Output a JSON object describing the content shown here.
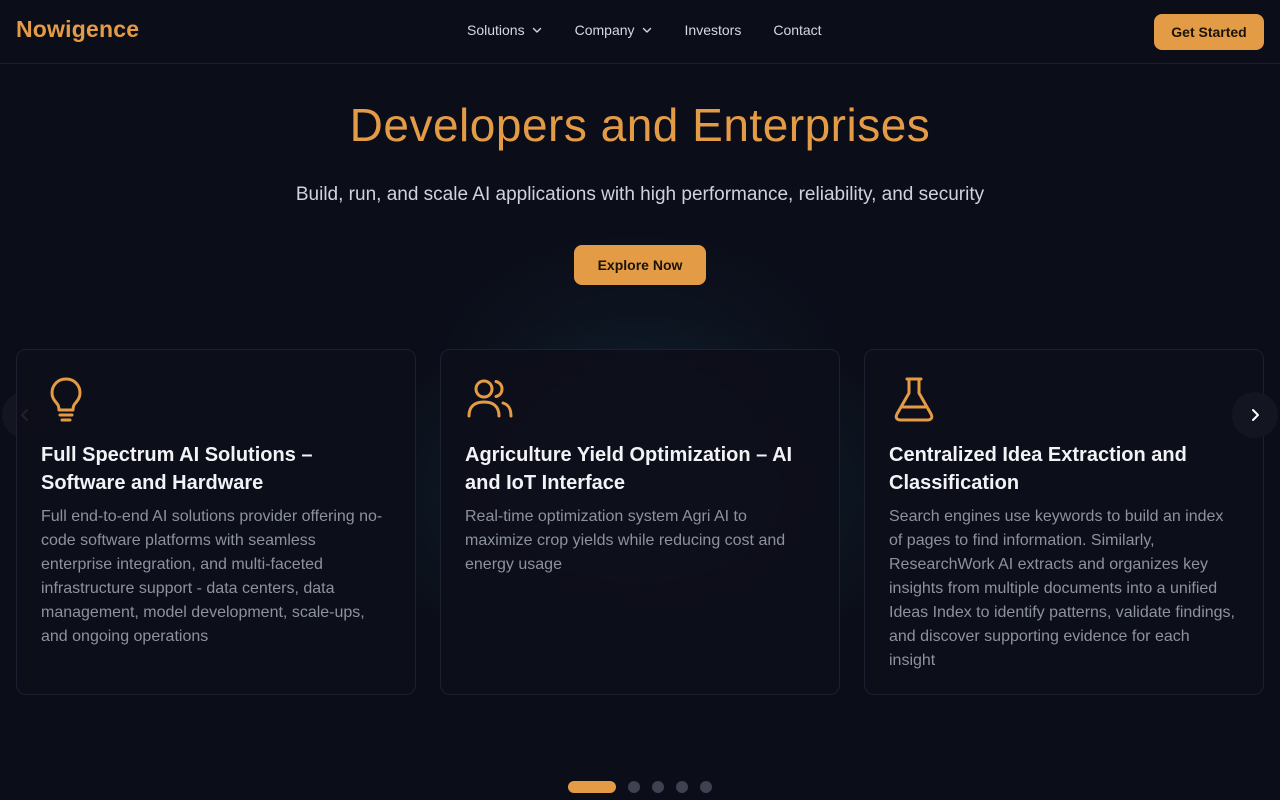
{
  "brand": {
    "name": "Nowigence"
  },
  "nav": {
    "links": [
      {
        "label": "Solutions",
        "has_menu": true
      },
      {
        "label": "Company",
        "has_menu": true
      },
      {
        "label": "Investors",
        "has_menu": false
      },
      {
        "label": "Contact",
        "has_menu": false
      }
    ],
    "cta_label": "Get Started"
  },
  "hero": {
    "title": "Developers and Enterprises",
    "subtitle": "Build, run, and scale AI applications with high performance, reliability, and security",
    "button_label": "Explore Now"
  },
  "cards": [
    {
      "icon": "lightbulb-icon",
      "title": "Full Spectrum AI Solutions – Software and Hardware",
      "description": "Full end-to-end AI solutions provider offering no-code software platforms with seamless enterprise integration, and multi-faceted infrastructure support - data centers, data management, model development, scale-ups, and ongoing operations"
    },
    {
      "icon": "users-icon",
      "title": "Agriculture Yield Optimization – AI and IoT Interface",
      "description": "Real-time optimization system Agri AI to maximize crop yields while reducing cost and energy usage"
    },
    {
      "icon": "flask-icon",
      "title": "Centralized Idea Extraction and Classification",
      "description": "Search engines use keywords to build an index of pages to find information. Similarly, ResearchWork AI extracts and organizes key insights from multiple documents into a unified Ideas Index to identify patterns, validate findings, and discover supporting evidence for each insight"
    }
  ],
  "carousel": {
    "slide_count": 5,
    "active_index": 0
  },
  "colors": {
    "accent": "#e49b46",
    "background": "#0b0e19",
    "card": "#0d0e1a",
    "muted_text": "#8d929f"
  }
}
